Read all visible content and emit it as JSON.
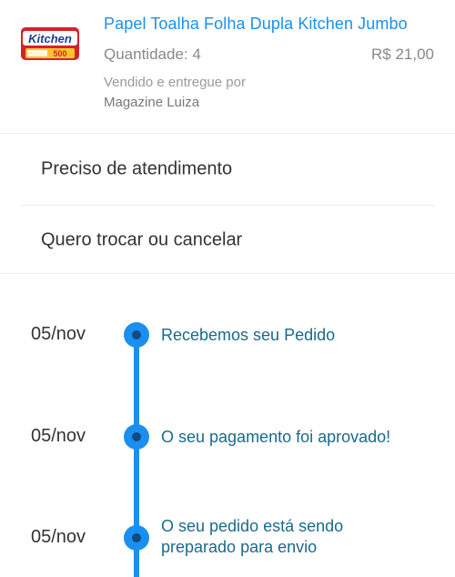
{
  "product": {
    "image_brand_text": "Kitchen",
    "image_badge_text": "500",
    "title": "Papel Toalha Folha Dupla Kitchen Jumbo",
    "quantity": "Quantidade: 4",
    "price": "R$ 21,00",
    "sold_by_label": "Vendido e entregue por",
    "seller": "Magazine Luiza"
  },
  "actions": [
    {
      "label": "Preciso de atendimento"
    },
    {
      "label": "Quero trocar ou cancelar"
    }
  ],
  "timeline": [
    {
      "date": "05/nov",
      "status_line1": "Recebemos seu Pedido",
      "status_line2": ""
    },
    {
      "date": "05/nov",
      "status_line1": "O seu pagamento foi aprovado!",
      "status_line2": ""
    },
    {
      "date": "05/nov",
      "status_line1": "O seu pedido está sendo",
      "status_line2": "preparado para envio"
    }
  ],
  "colors": {
    "accent": "#1a8ff0",
    "timeline_text": "#1a6a8a",
    "dot_center": "#114a80"
  }
}
